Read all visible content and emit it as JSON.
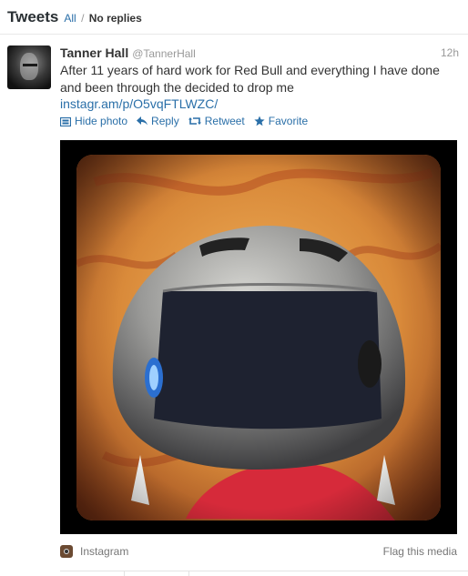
{
  "header": {
    "title": "Tweets",
    "filter_all": "All",
    "filter_sep": "/",
    "filter_noreplies": "No replies"
  },
  "tweet": {
    "fullname": "Tanner Hall",
    "username": "@TannerHall",
    "time": "12h",
    "text": "After 11 years of hard work for Red Bull and everything I have done and been through the decided to drop me",
    "link": "instagr.am/p/O5vqFTLWZC/",
    "actions": {
      "hide_photo": "Hide photo",
      "reply": "Reply",
      "retweet": "Retweet",
      "favorite": "Favorite"
    },
    "media": {
      "source": "Instagram",
      "flag": "Flag this media"
    }
  },
  "colors": {
    "link": "#2a6fa8",
    "text": "#333333",
    "muted": "#999999"
  }
}
